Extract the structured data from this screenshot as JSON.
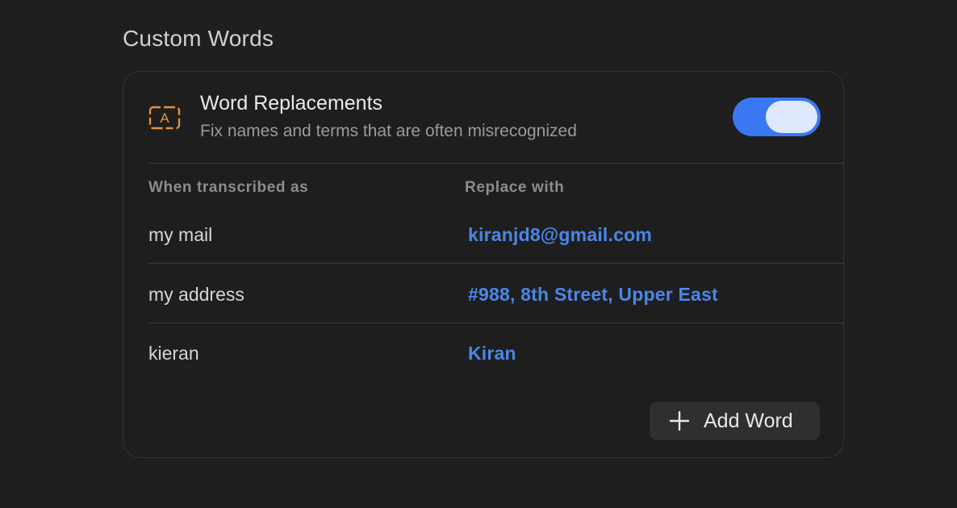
{
  "section": {
    "title": "Custom Words"
  },
  "card": {
    "icon": "text-replace-icon",
    "icon_letter": "A",
    "title": "Word Replacements",
    "description": "Fix names and terms that are often misrecognized",
    "toggle": {
      "state": "on",
      "color": "#3a78f2"
    }
  },
  "table": {
    "headers": {
      "from": "When transcribed as",
      "to": "Replace with"
    },
    "rows": [
      {
        "from": "my mail",
        "to": "kiranjd8@gmail.com"
      },
      {
        "from": "my address",
        "to": "#988, 8th Street, Upper East"
      },
      {
        "from": "kieran",
        "to": "Kiran"
      }
    ]
  },
  "add_button": {
    "icon": "plus-icon",
    "label": "Add Word"
  },
  "colors": {
    "accent": "#3a78f2",
    "link": "#4a86e8",
    "icon": "#e8913a",
    "background": "#1f1f1f"
  }
}
